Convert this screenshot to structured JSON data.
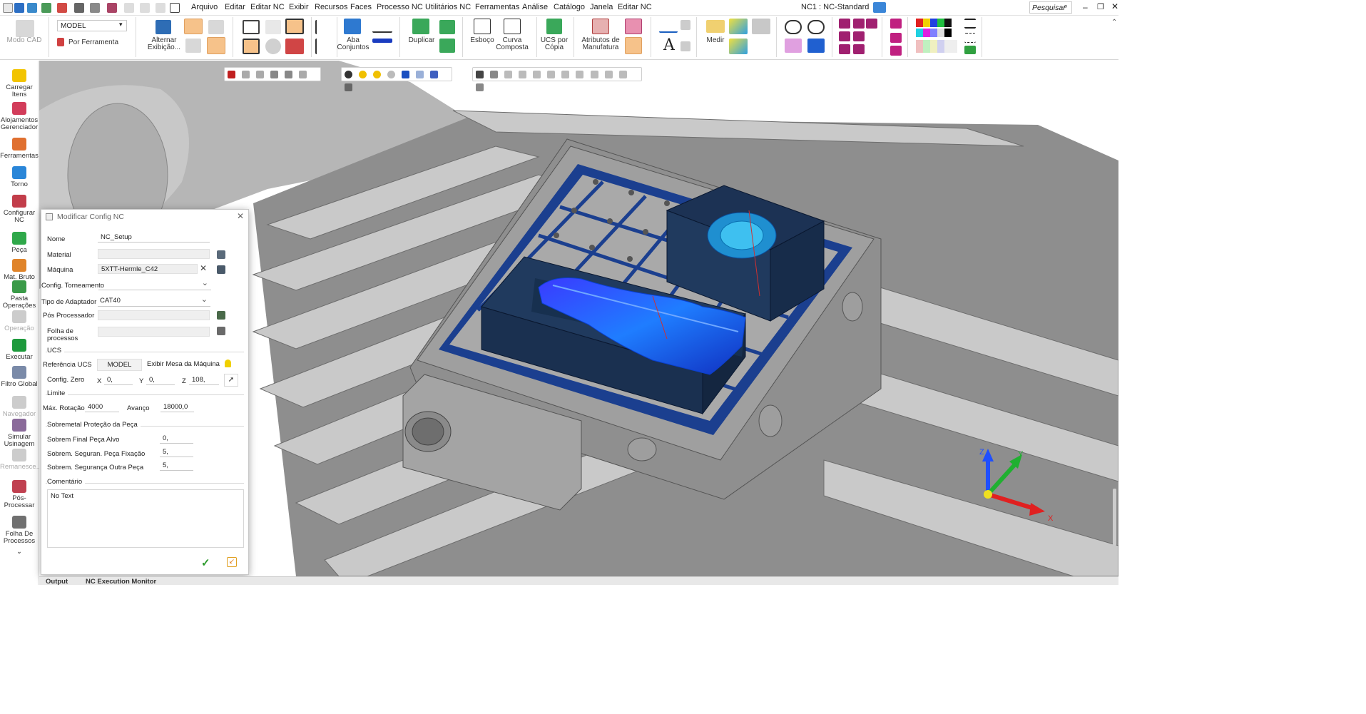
{
  "app": {
    "title": "NC1 : NC-Standard",
    "search_label": "Pesquisar"
  },
  "menu": [
    "Arquivo",
    "Editar",
    "Editar NC",
    "Exibir",
    "Recursos",
    "Faces",
    "Processo NC",
    "Utilitários NC",
    "Ferramentas",
    "Análise",
    "Catálogo",
    "Janela",
    "Editar NC"
  ],
  "ribbon": {
    "modo_cad": "Modo CAD",
    "model_select": "MODEL",
    "por_ferramenta": "Por Ferramenta",
    "alternar": "Alternar\nExibição...",
    "aba_conjuntos": "Aba\nConjuntos",
    "duplicar": "Duplicar",
    "esboco": "Esboço",
    "curva_composta": "Curva\nComposta",
    "ucs_copia": "UCS por\nCópia",
    "atributos": "Atributos de\nManufatura",
    "medir": "Medir"
  },
  "left_toolbar": [
    {
      "label": "Carregar\nItens",
      "icon": "load-items-icon",
      "enabled": true,
      "color": "#f2c400"
    },
    {
      "label": "Alojamentos\nGerenciador",
      "icon": "housing-manager-icon",
      "enabled": true,
      "color": "#d23c5a"
    },
    {
      "label": "Ferramentas",
      "icon": "tools-icon",
      "enabled": true,
      "color": "#e07030"
    },
    {
      "label": "Torno",
      "icon": "lathe-icon",
      "enabled": true,
      "color": "#2a86d8"
    },
    {
      "label": "Configurar\nNC",
      "icon": "configure-nc-icon",
      "enabled": true,
      "color": "#c23d4a"
    },
    {
      "label": "Peça",
      "icon": "part-icon",
      "enabled": true,
      "color": "#2fa84a"
    },
    {
      "label": "Mat. Bruto",
      "icon": "stock-icon",
      "enabled": true,
      "color": "#e0842a"
    },
    {
      "label": "Pasta\nOperações",
      "icon": "operations-folder-icon",
      "enabled": true,
      "color": "#3a9a48"
    },
    {
      "label": "Operação",
      "icon": "operation-icon",
      "enabled": false,
      "color": "#cccccc"
    },
    {
      "label": "Executar",
      "icon": "execute-icon",
      "enabled": true,
      "color": "#1d9a3c"
    },
    {
      "label": "Filtro Global",
      "icon": "global-filter-icon",
      "enabled": true,
      "color": "#7a8aa8"
    },
    {
      "label": "Navegador",
      "icon": "navigator-icon",
      "enabled": false,
      "color": "#cccccc"
    },
    {
      "label": "Simular\nUsinagem",
      "icon": "simulate-icon",
      "enabled": true,
      "color": "#8a6a9a"
    },
    {
      "label": "Remanesce...",
      "icon": "remaining-icon",
      "enabled": false,
      "color": "#cccccc"
    },
    {
      "label": "Pós-\nProcessar",
      "icon": "post-process-icon",
      "enabled": true,
      "color": "#c04050"
    },
    {
      "label": "Folha De\nProcessos",
      "icon": "process-sheet-icon",
      "enabled": true,
      "color": "#707070"
    }
  ],
  "dialog": {
    "title": "Modificar Config NC",
    "nome_label": "Nome",
    "nome_value": "NC_Setup",
    "material_label": "Material",
    "material_value": "",
    "maquina_label": "Máquina",
    "maquina_value": "5XTT-Hermle_C42",
    "config_torneamento_label": "Config. Torneamento",
    "config_torneamento_value": "",
    "tipo_adaptador_label": "Tipo de Adaptador",
    "tipo_adaptador_value": "CAT40",
    "pos_processador_label": "Pós Processador",
    "pos_processador_value": "",
    "folha_label": "Folha de\nprocessos",
    "folha_value": "",
    "ucs_section": "UCS",
    "referencia_ucs_label": "Referência UCS",
    "referencia_ucs_value": "MODEL",
    "exibir_mesa_label": "Exibir Mesa da Máquina",
    "config_zero_label": "Config. Zero",
    "x_label": "X",
    "x_value": "0,",
    "y_label": "Y",
    "y_value": "0,",
    "z_label": "Z",
    "z_value": "108,",
    "limite_section": "Limite",
    "max_rotacao_label": "Máx. Rotação",
    "max_rotacao_value": "4000",
    "avanco_label": "Avanço",
    "avanco_value": "18000,0",
    "sobremetal_section": "Sobremetal Proteção da Peça",
    "sobrem_final_label": "Sobrem Final Peça Alvo",
    "sobrem_final_value": "0,",
    "sobrem_fixacao_label": "Sobrem. Seguran. Peça Fixação",
    "sobrem_fixacao_value": "5,",
    "sobrem_outra_label": "Sobrem. Segurança Outra Peça",
    "sobrem_outra_value": "5,",
    "comentario_section": "Comentário",
    "comentario_value": "No Text"
  },
  "axes": {
    "x": "X",
    "y": "Y",
    "z": "Z"
  },
  "bottom_tabs": [
    "Output",
    "NC Execution Monitor"
  ],
  "colors": {
    "accent": "#1e5fb4",
    "fixture_blue": "#1b3f8f",
    "block_dark": "#203a5e",
    "toolpath": "#1f7dff"
  }
}
